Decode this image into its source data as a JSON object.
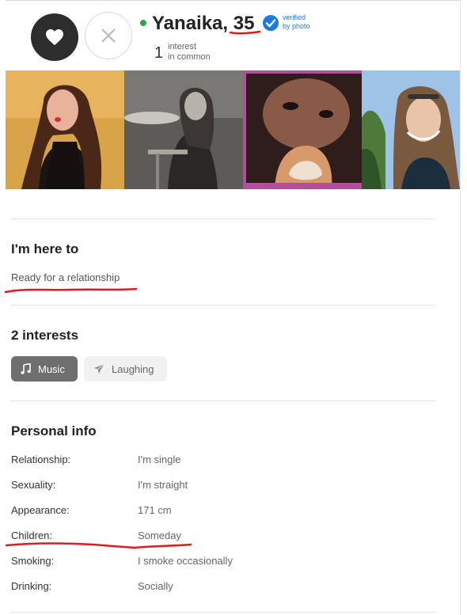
{
  "profile": {
    "name": "Yanaika,",
    "age": "35",
    "verified_line1": "verified",
    "verified_line2": "by photo",
    "common_count": "1",
    "common_line1": "interest",
    "common_line2": "in common"
  },
  "icons": {
    "like": "heart-icon",
    "dismiss": "close-icon",
    "verified": "check-badge-icon",
    "music": "music-note-icon",
    "laughing": "paper-plane-icon"
  },
  "colors": {
    "online": "#2fa44f",
    "verified": "#1d7ae0",
    "annotation": "#e01b1b"
  },
  "here_to": {
    "title": "I'm here to",
    "value": "Ready for a relationship"
  },
  "interests": {
    "title": "2 interests",
    "chips": [
      {
        "label": "Music"
      },
      {
        "label": "Laughing"
      }
    ]
  },
  "personal_info": {
    "title": "Personal info",
    "rows": [
      {
        "label": "Relationship:",
        "value": "I'm single"
      },
      {
        "label": "Sexuality:",
        "value": "I'm straight"
      },
      {
        "label": "Appearance:",
        "value": "171 cm"
      },
      {
        "label": "Children:",
        "value": "Someday"
      },
      {
        "label": "Smoking:",
        "value": "I smoke occasionally"
      },
      {
        "label": "Drinking:",
        "value": "Socially"
      }
    ]
  }
}
